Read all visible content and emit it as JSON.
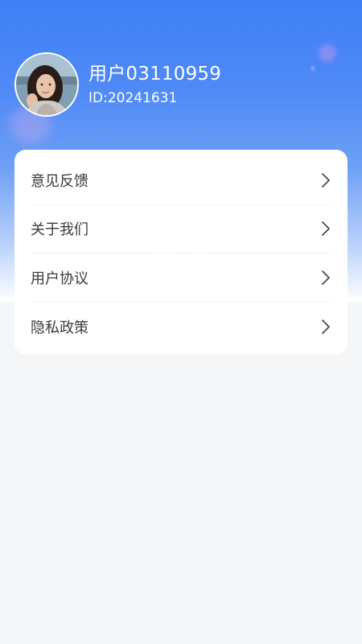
{
  "profile": {
    "username": "用户03110959",
    "user_id": "ID:20241631",
    "avatar_icon": "user-avatar-photo"
  },
  "menu": {
    "items": [
      {
        "label": "意见反馈",
        "icon": "chevron-right-icon"
      },
      {
        "label": "关于我们",
        "icon": "chevron-right-icon"
      },
      {
        "label": "用户协议",
        "icon": "chevron-right-icon"
      },
      {
        "label": "隐私政策",
        "icon": "chevron-right-icon"
      }
    ]
  },
  "colors": {
    "header_gradient_top": "#3f80f7",
    "page_background": "#f5f6f8",
    "card_background": "#ffffff",
    "label_text": "#3a3a3a",
    "chevron": "#4a4a4a"
  }
}
